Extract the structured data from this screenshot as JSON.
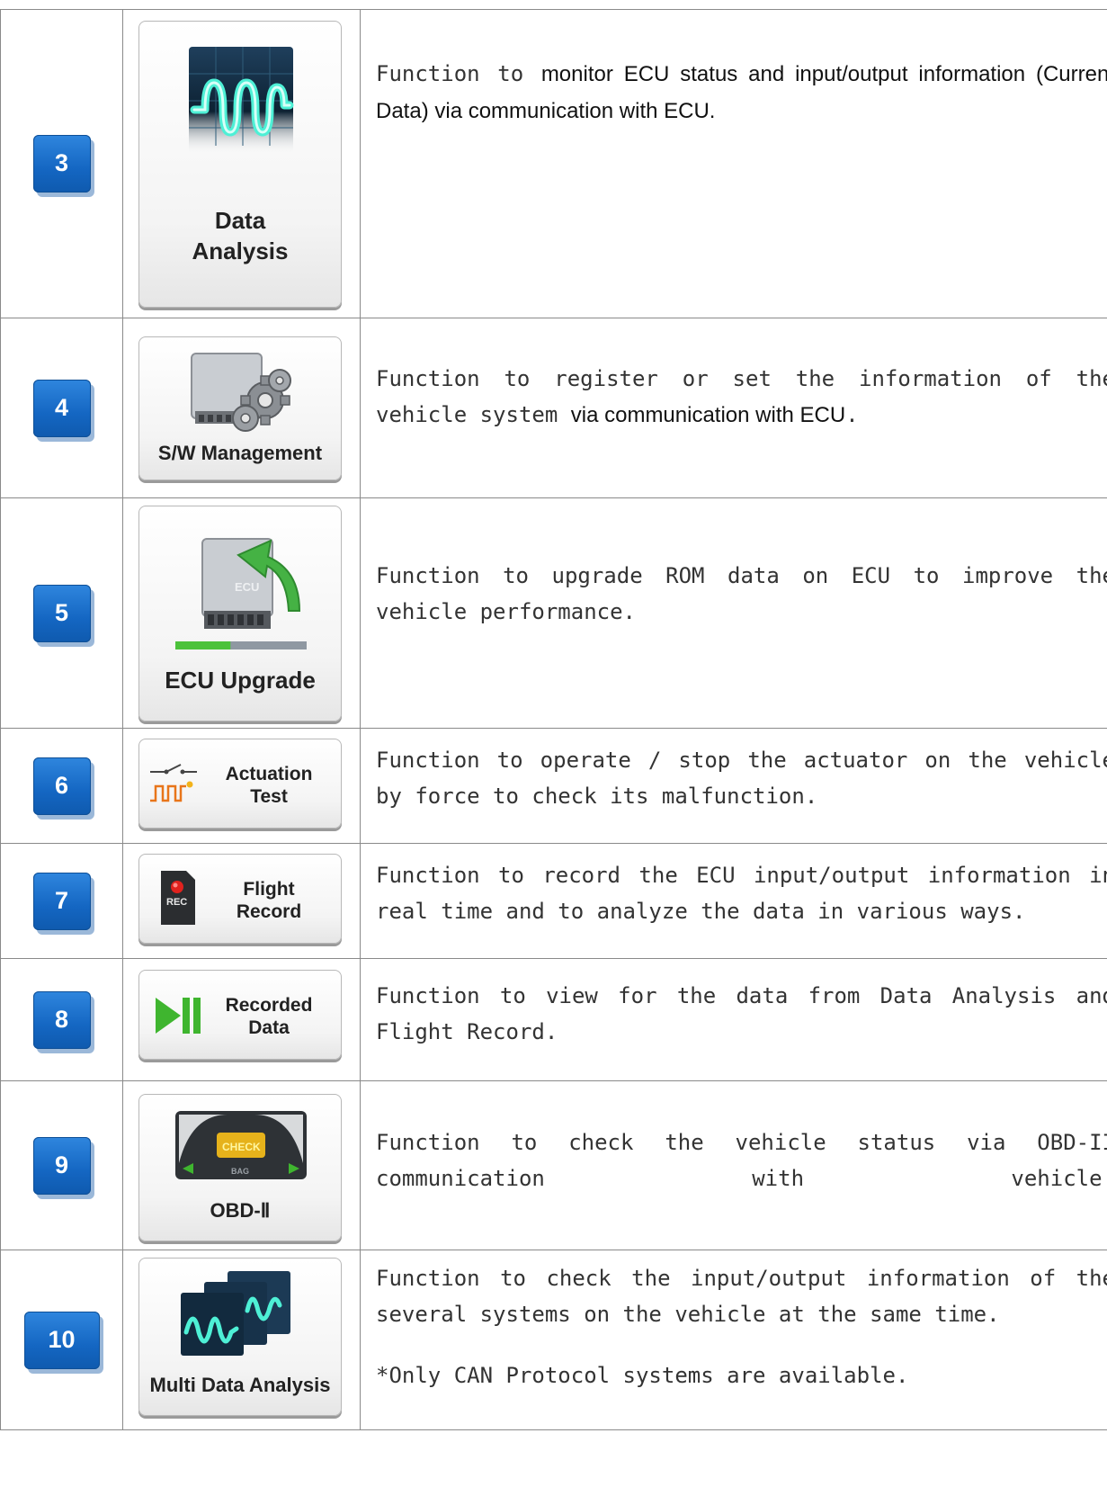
{
  "rows": [
    {
      "number": "3",
      "tile_label_line1": "Data",
      "tile_label_line2": "Analysis",
      "desc_mono": "Function to ",
      "desc_sans": "monitor ECU status and input/output information (Current Data) via communication with ECU."
    },
    {
      "number": "4",
      "tile_label": "S/W Management",
      "desc_mono_1": "Function to register or set the information of the vehicle system ",
      "desc_sans": "via communication with ECU",
      "desc_mono_2": "."
    },
    {
      "number": "5",
      "tile_label": "ECU Upgrade",
      "icon_text": "ECU",
      "progress": 0.42,
      "desc": "Function to upgrade ROM data on ECU to improve the vehicle performance."
    },
    {
      "number": "6",
      "tile_label_line1": "Actuation",
      "tile_label_line2": "Test",
      "desc": "Function to operate / stop the actuator on the vehicle by force to check its malfunction."
    },
    {
      "number": "7",
      "tile_label_line1": "Flight",
      "tile_label_line2": "Record",
      "icon_text": "REC",
      "desc": "Function to record the ECU input/output information in real time and to analyze the data in various ways."
    },
    {
      "number": "8",
      "tile_label_line1": "Recorded",
      "tile_label_line2": "Data",
      "desc": "Function to view for the data from Data Analysis and Flight Record."
    },
    {
      "number": "9",
      "tile_label": "OBD-Ⅱ",
      "icon_text": "CHECK",
      "icon_text_2": "BAG",
      "desc": "Function to check the vehicle status via OBD-II communication with vehicle."
    },
    {
      "number": "10",
      "tile_label": "Multi Data Analysis",
      "desc": "Function to check the input/output information of the several systems on the vehicle at the same time.",
      "note": "*Only CAN Protocol systems are available."
    }
  ],
  "colors": {
    "badge_blue": "#1a6fca",
    "border": "#8a8a8a",
    "scope_green": "#3fe0c8",
    "progress_green": "#4cc23b",
    "arrow_green": "#3fa93a",
    "rec_red": "#e0221e"
  },
  "icons": {
    "row3": "oscilloscope-wave-icon",
    "row4": "ecu-gears-icon",
    "row5": "ecu-upgrade-arrow-icon",
    "row6": "switch-pulse-icon",
    "row7": "sd-card-rec-icon",
    "row8": "play-pause-icon",
    "row9": "dashboard-check-engine-icon",
    "row10": "multi-scope-icon"
  }
}
